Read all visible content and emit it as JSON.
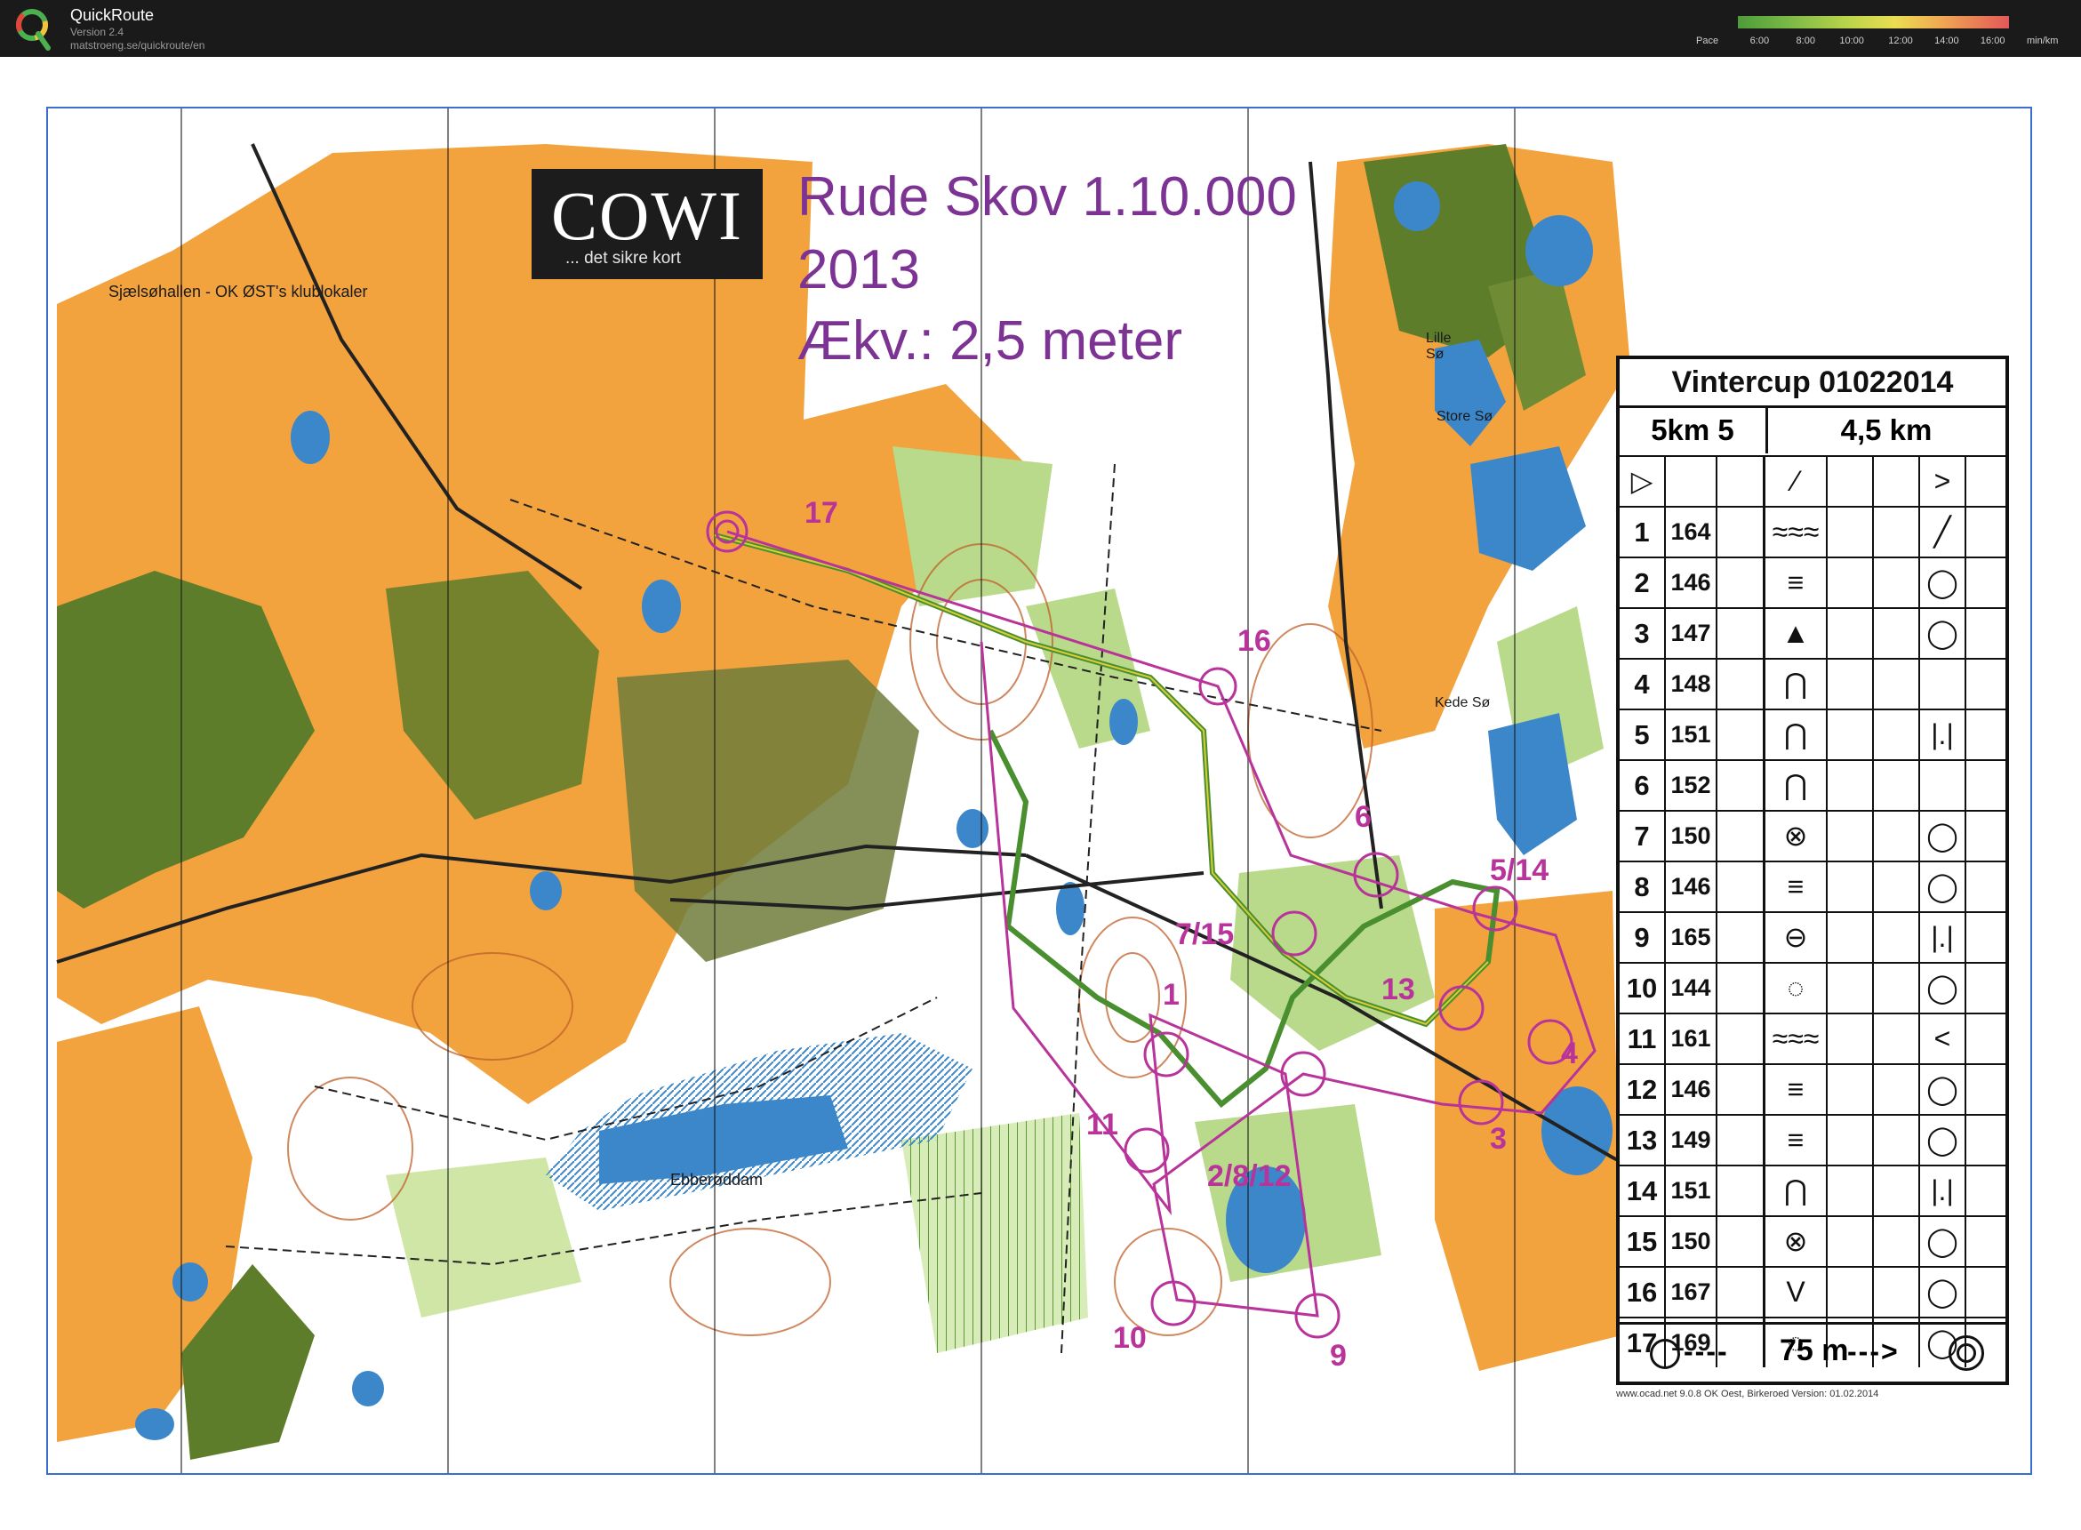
{
  "app": {
    "title": "QuickRoute",
    "version": "Version 2.4",
    "url": "matstroeng.se/quickroute/en"
  },
  "pace_legend": {
    "label": "Pace",
    "ticks": [
      "6:00",
      "8:00",
      "10:00",
      "12:00",
      "14:00",
      "16:00"
    ],
    "unit": "min/km",
    "colors": [
      "#4e9b3a",
      "#b9d44a",
      "#eadd52",
      "#f0a552",
      "#e2585a"
    ]
  },
  "map": {
    "publisher_logo": "COWI",
    "publisher_tagline": "... det sikre kort",
    "title_line1": "Rude Skov 1.10.000",
    "title_line2": "2013",
    "title_line3": "Ækv.: 2,5 meter",
    "clubhouse_label": "Sjælsøhallen - OK ØST's klublokaler",
    "lakes": {
      "ebberoddam": "Ebberøddam",
      "lille_so": "Lille Sø",
      "store_so": "Store Sø",
      "kede_so": "Kede Sø"
    },
    "printer_note": "www.ocad.net  9.0.8  OK Oest, Birkeroed  Version: 01.02.2014",
    "colors": {
      "open_land": "#f3a33e",
      "forest_green": "#5d7d2b",
      "light_green": "#b9d98b",
      "water": "#3b87c9",
      "course_magenta": "#b8339a",
      "contour_brown": "#c0602a",
      "route_green": "#4a8f2f",
      "route_yellow": "#d9cc36"
    }
  },
  "control_numbers": [
    "17",
    "16",
    "6",
    "5/14",
    "7/15",
    "13",
    "1",
    "4",
    "3",
    "11",
    "2/8/12",
    "10",
    "9"
  ],
  "description_sheet": {
    "event": "Vintercup 01022014",
    "course": "5km 5",
    "length": "4,5 km",
    "rows": [
      {
        "num": "1",
        "code": "164",
        "feature": "≈≈≈",
        "position": "╱"
      },
      {
        "num": "2",
        "code": "146",
        "feature": "≡",
        "position": "◯"
      },
      {
        "num": "3",
        "code": "147",
        "feature": "▲",
        "position": "◯"
      },
      {
        "num": "4",
        "code": "148",
        "feature": "⋂",
        "position": ""
      },
      {
        "num": "5",
        "code": "151",
        "feature": "⋂",
        "position": "|.|"
      },
      {
        "num": "6",
        "code": "152",
        "feature": "⋂",
        "position": ""
      },
      {
        "num": "7",
        "code": "150",
        "feature": "⊗",
        "position": "◯"
      },
      {
        "num": "8",
        "code": "146",
        "feature": "≡",
        "position": "◯"
      },
      {
        "num": "9",
        "code": "165",
        "feature": "⊖",
        "position": "|.|"
      },
      {
        "num": "10",
        "code": "144",
        "feature": "◌",
        "position": "◯"
      },
      {
        "num": "11",
        "code": "161",
        "feature": "≈≈≈",
        "position": "<"
      },
      {
        "num": "12",
        "code": "146",
        "feature": "≡",
        "position": "◯"
      },
      {
        "num": "13",
        "code": "149",
        "feature": "≡",
        "position": "◯"
      },
      {
        "num": "14",
        "code": "151",
        "feature": "⋂",
        "position": "|.|"
      },
      {
        "num": "15",
        "code": "150",
        "feature": "⊗",
        "position": "◯"
      },
      {
        "num": "16",
        "code": "167",
        "feature": "V",
        "position": "◯"
      },
      {
        "num": "17",
        "code": "169",
        "feature": "◌",
        "position": "◯"
      }
    ],
    "start_symbol": "▷",
    "finish_distance": "75 m",
    "finish_dashes": "----",
    "finish_arrow": "--->"
  }
}
